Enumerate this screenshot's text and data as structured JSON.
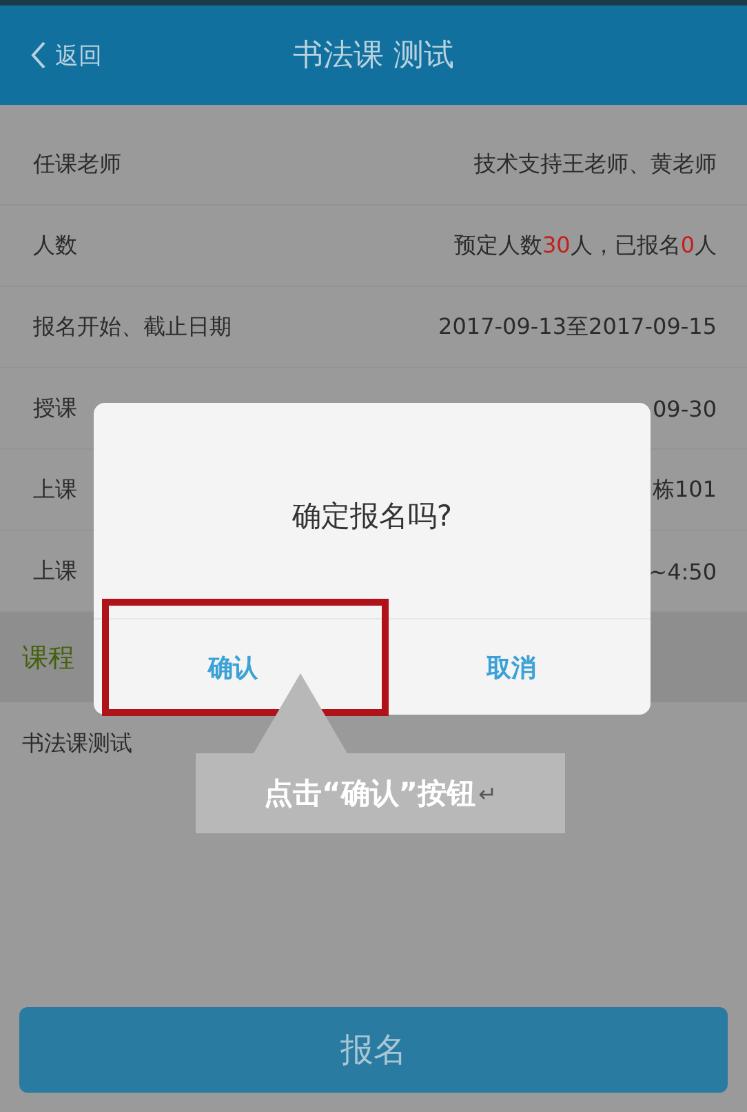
{
  "header": {
    "back_label": "返回",
    "title": "书法课 测试"
  },
  "rows": [
    {
      "label": "任课老师",
      "value": [
        {
          "text": "技术支持王老师、黄老师",
          "highlight": false
        }
      ]
    },
    {
      "label": "人数",
      "value": [
        {
          "text": "预定人数",
          "highlight": false
        },
        {
          "text": "30",
          "highlight": true
        },
        {
          "text": "人，已报名",
          "highlight": false
        },
        {
          "text": "0",
          "highlight": true
        },
        {
          "text": "人",
          "highlight": false
        }
      ]
    },
    {
      "label": "报名开始、截止日期",
      "value": [
        {
          "text": "2017-09-13至2017-09-15",
          "highlight": false
        }
      ]
    },
    {
      "label": "授课",
      "value": [
        {
          "text": "09-30",
          "highlight": false
        }
      ]
    },
    {
      "label": "上课",
      "value": [
        {
          "text": "栋101",
          "highlight": false
        }
      ]
    },
    {
      "label": "上课",
      "value": [
        {
          "text": "~4:50",
          "highlight": false
        }
      ]
    }
  ],
  "section": {
    "title": "课程"
  },
  "course_rows": [
    "书法课测试"
  ],
  "signup_button": "报名",
  "dialog": {
    "message": "确定报名吗?",
    "buttons": [
      {
        "label": "确认",
        "highlighted": true
      },
      {
        "label": "取消",
        "highlighted": false
      }
    ]
  },
  "annotation": {
    "text": "点击“确认”按钮",
    "mark": "↵"
  }
}
